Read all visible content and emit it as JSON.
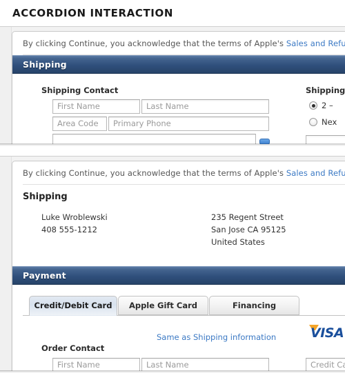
{
  "page": {
    "title": "ACCORDION INTERACTION"
  },
  "colors": {
    "section_bar_top": "#5b7ba6",
    "section_bar_bottom": "#274469",
    "link_blue": "#3b79c4",
    "visa_blue": "#1a4f9c",
    "visa_gold": "#f4a428",
    "active_tab_bg": "#dde6f1"
  },
  "panel_top": {
    "legal": {
      "text_before_link": "By clicking Continue, you acknowledge that the terms of Apple's ",
      "link_text": "Sales and Refund Policy"
    },
    "section": {
      "title": "Shipping"
    },
    "form": {
      "contact_heading": "Shipping Contact",
      "fields": [
        {
          "placeholder": "First Name"
        },
        {
          "placeholder": "Last Name"
        },
        {
          "placeholder": "Area Code"
        },
        {
          "placeholder": "Primary Phone"
        }
      ],
      "method_heading": "Shipping M",
      "radios": [
        {
          "label": "2 –",
          "checked": true
        },
        {
          "label": "Nex",
          "checked": false
        }
      ]
    }
  },
  "panel_bottom": {
    "legal": {
      "text_before_link": "By clicking Continue, you acknowledge that the terms of Apple's ",
      "link_text": "Sales and Refund Policy"
    },
    "shipping_summary": {
      "heading": "Shipping",
      "name": "Luke Wroblewski",
      "phone": "408 555-1212",
      "address_line1": "235 Regent Street",
      "address_line2": "San Jose CA 95125",
      "address_line3": "United States"
    },
    "payment": {
      "section_title": "Payment",
      "tabs": [
        {
          "label": "Credit/Debit Card",
          "active": true
        },
        {
          "label": "Apple Gift Card",
          "active": false
        },
        {
          "label": "Financing",
          "active": false
        }
      ],
      "same_as_shipping_link": "Same as Shipping information",
      "order_contact_heading": "Order Contact",
      "fields": [
        {
          "placeholder": "First Name"
        },
        {
          "placeholder": "Last Name"
        },
        {
          "placeholder": "Credit Ca"
        }
      ],
      "card_logo": "visa-logo"
    }
  }
}
